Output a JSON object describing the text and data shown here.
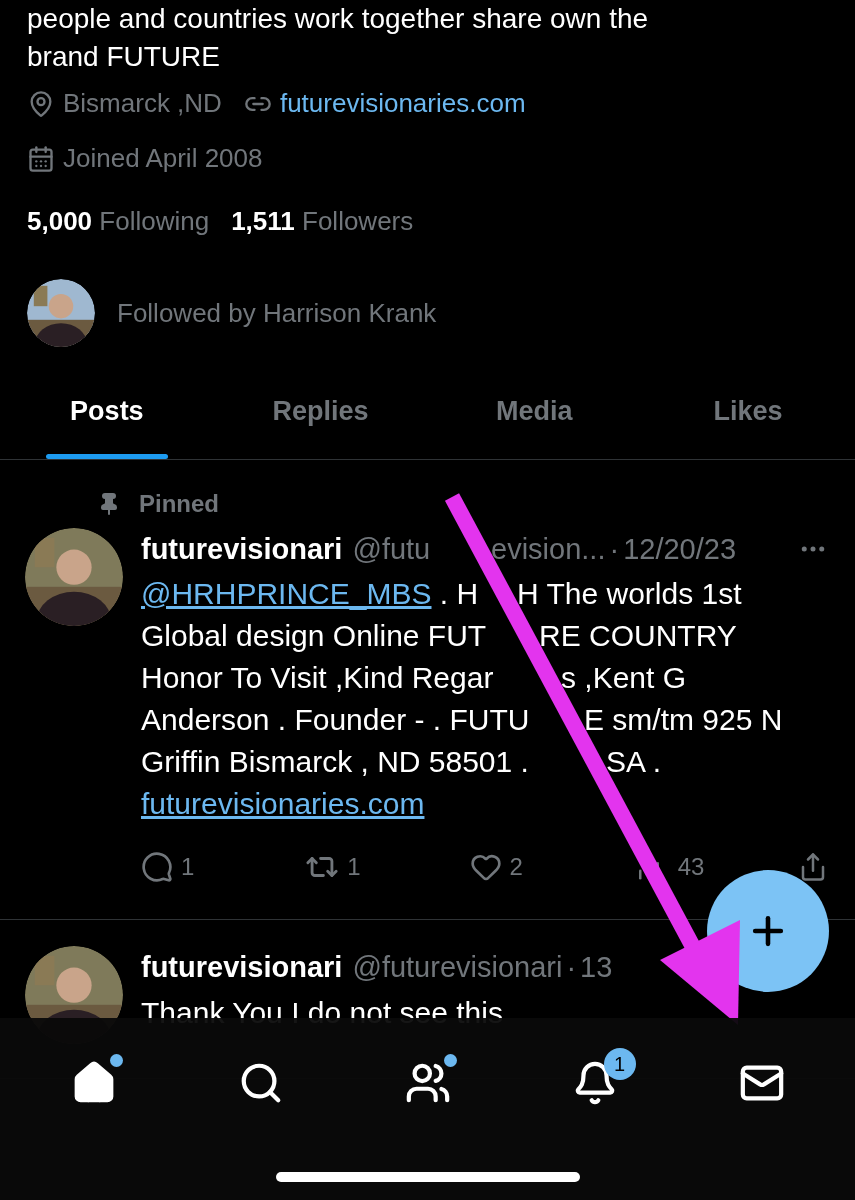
{
  "profile": {
    "bio": [
      "people and countries work together share own the",
      "brand FUTURE"
    ],
    "location": "Bismarck ,ND",
    "website": "futurevisionaries.com",
    "joined": "Joined April 2008",
    "following_count": "5,000",
    "following_label": "Following",
    "followers_count": "1,511",
    "followers_label": "Followers",
    "followed_by": "Followed by Harrison Krank"
  },
  "tabs": [
    {
      "label": "Posts",
      "selected": true
    },
    {
      "label": "Replies",
      "selected": false
    },
    {
      "label": "Media",
      "selected": false
    },
    {
      "label": "Likes",
      "selected": false
    }
  ],
  "posts": [
    {
      "pinned": true,
      "pinned_label": "Pinned",
      "name": "futurevisionari",
      "handle": "@futu",
      "handle_rest": "evision...",
      "dot": "·",
      "date": "12/20/23",
      "more_menu": true,
      "lines": [
        {
          "before": [
            {
              "kind": "mention",
              "text": "@HRHPRINCE_MBS"
            },
            {
              "kind": "text",
              "text": " . H"
            }
          ],
          "after": "H The worlds 1st"
        },
        {
          "before": [
            {
              "kind": "text",
              "text": "Global design Online FUT"
            }
          ],
          "after": "RE COUNTRY"
        },
        {
          "before": [
            {
              "kind": "text",
              "text": "Honor To Visit ,Kind Regar"
            }
          ],
          "after": "s ,Kent G"
        },
        {
          "before": [
            {
              "kind": "text",
              "text": "Anderson . Founder - . FUTU"
            }
          ],
          "after": "E sm/tm 925 N"
        },
        {
          "before": [
            {
              "kind": "text",
              "text": "Griffin Bismarck , ND 58501 ."
            }
          ],
          "after": "SA ."
        },
        {
          "before": [
            {
              "kind": "link",
              "text": "futurevisionaries.com"
            }
          ]
        }
      ],
      "replies": "1",
      "reposts": "1",
      "likes": "2",
      "views": "43"
    },
    {
      "pinned": false,
      "name": "futurevisionari",
      "handle": "@futurevisionari",
      "dot": "·",
      "date": "13",
      "lines": [
        {
          "before": [
            {
              "kind": "text",
              "text": "Thank You I do not see this"
            }
          ]
        }
      ]
    }
  ],
  "nav": [
    {
      "kind": "home",
      "dot": true
    },
    {
      "kind": "search",
      "dot": false
    },
    {
      "kind": "communities",
      "dot": true
    },
    {
      "kind": "notifications",
      "dot": false,
      "badge": "1"
    },
    {
      "kind": "messages",
      "dot": false
    }
  ]
}
